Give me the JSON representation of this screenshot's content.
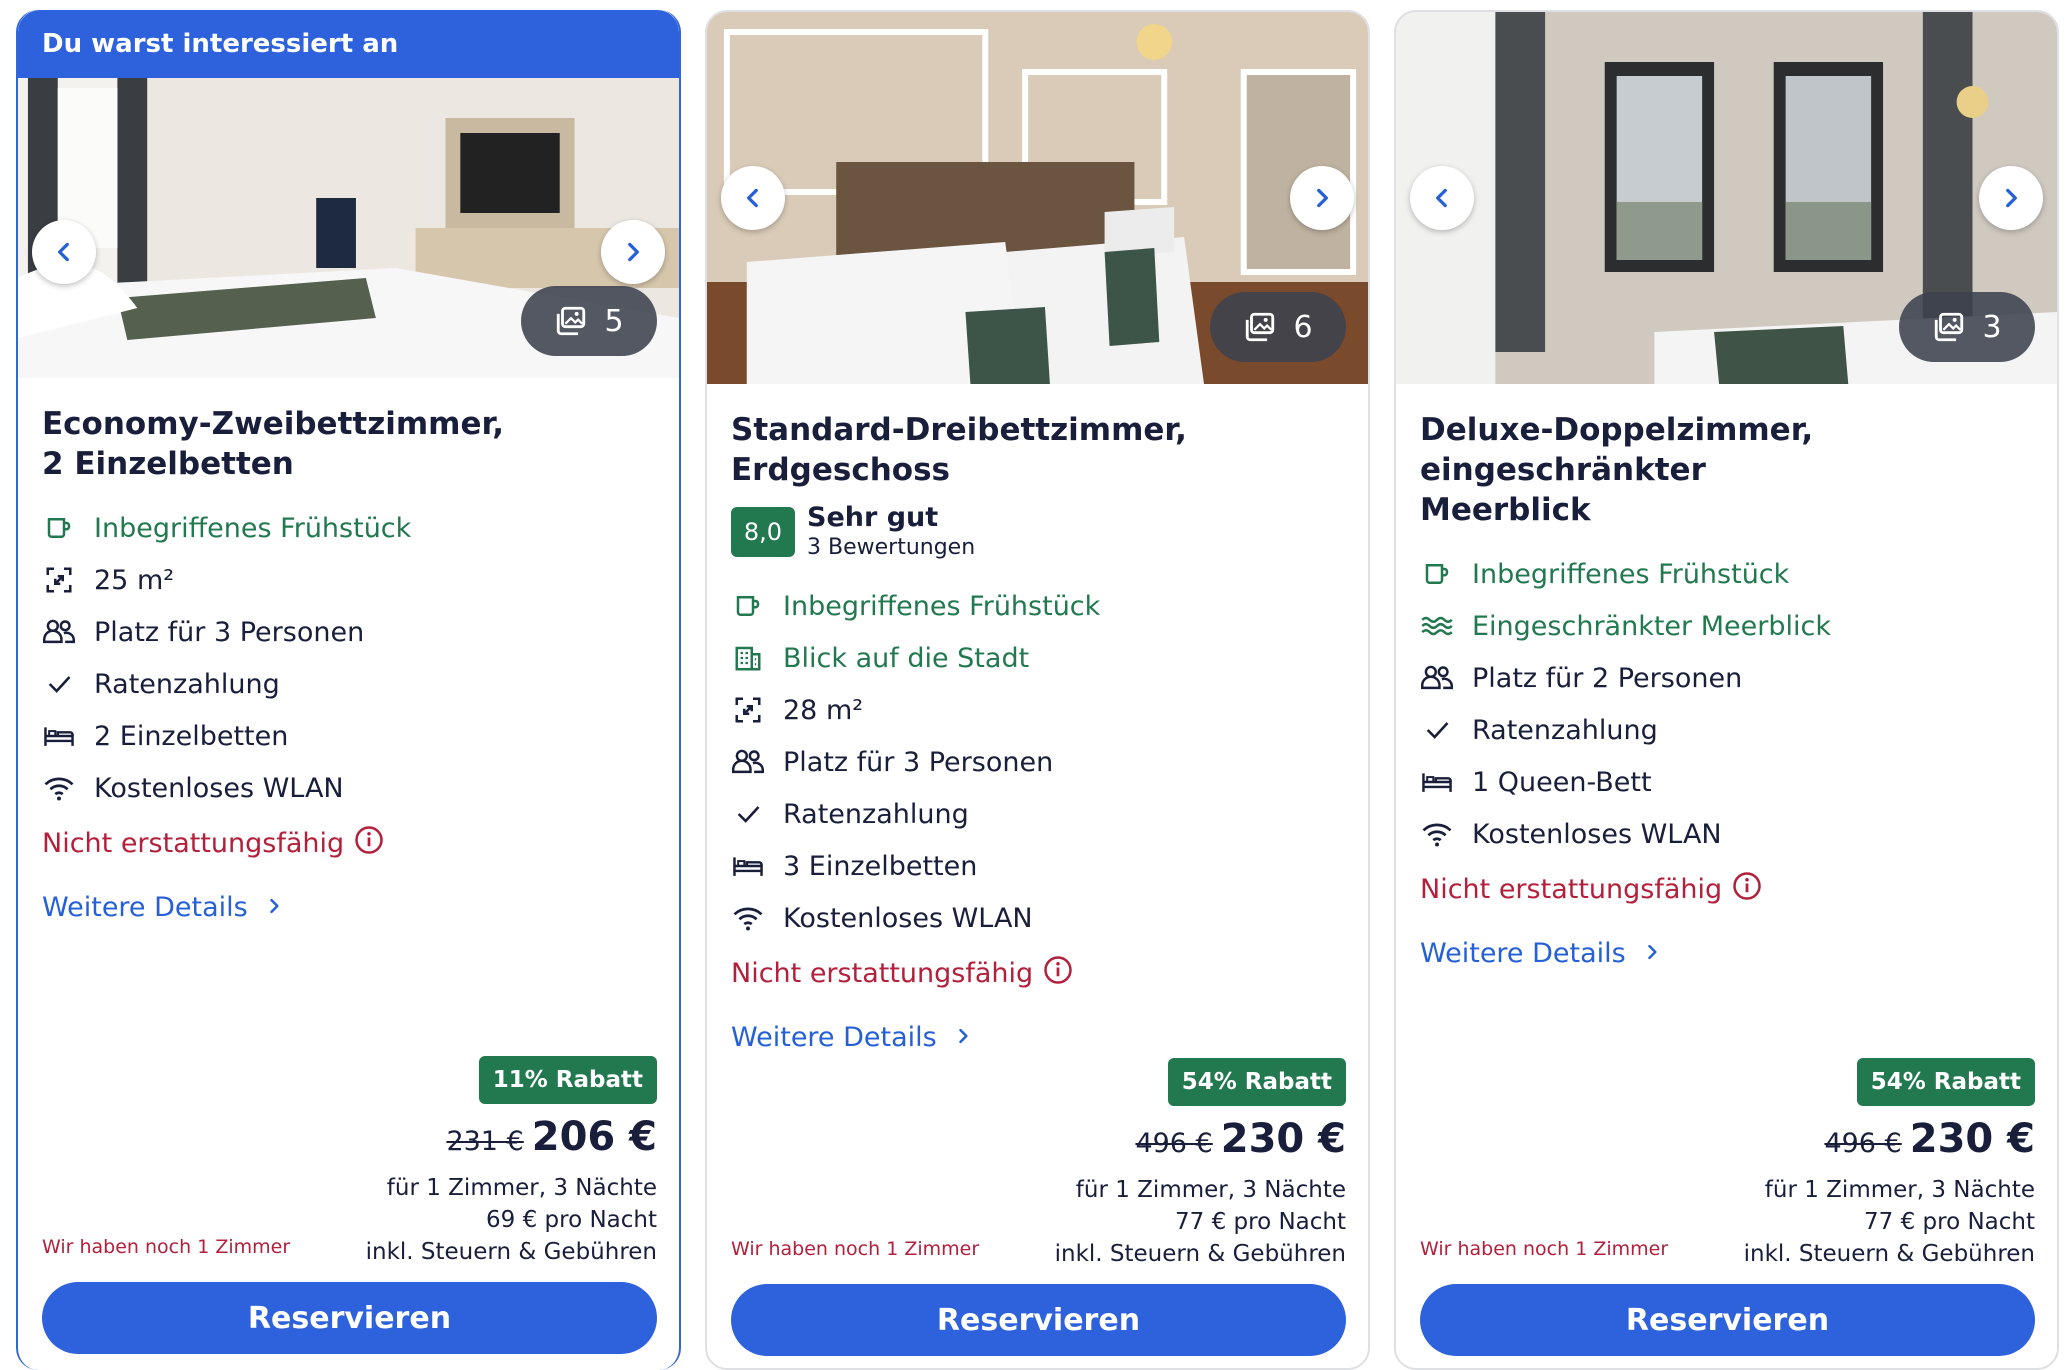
{
  "colors": {
    "brand_blue": "#2e62dc",
    "green": "#227950",
    "red": "#b3203b",
    "link_blue": "#2560d6"
  },
  "cards": [
    {
      "banner": "Du warst interessiert an",
      "photo_count": "5",
      "title": "Economy-Zweibettzimmer, 2 Einzelbetten",
      "title_line1": "Economy-Zweibettzimmer,",
      "title_line2": "2 Einzelbetten",
      "features": [
        {
          "icon": "breakfast-icon",
          "text": "Inbegriffenes Frühstück",
          "highlight": true
        },
        {
          "icon": "room-size-icon",
          "text": "25 m²",
          "highlight": false
        },
        {
          "icon": "guests-icon",
          "text": "Platz für 3 Personen",
          "highlight": false
        },
        {
          "icon": "check-icon",
          "text": "Ratenzahlung",
          "highlight": false
        },
        {
          "icon": "bed-icon",
          "text": "2 Einzelbetten",
          "highlight": false
        },
        {
          "icon": "wifi-icon",
          "text": "Kostenloses WLAN",
          "highlight": false
        }
      ],
      "refund": "Nicht erstattungsfähig",
      "details": "Weitere Details",
      "discount": "11% Rabatt",
      "old_price": "231 €",
      "price": "206 €",
      "price_note1": "für 1 Zimmer, 3 Nächte",
      "price_note2": "69 € pro Nacht",
      "price_note3": "inkl. Steuern & Gebühren",
      "rooms_left": "Wir haben noch 1 Zimmer",
      "reserve": "Reservieren"
    },
    {
      "photo_count": "6",
      "title_line1": "Standard-Dreibettzimmer, Erdgeschoss",
      "score": "8,0",
      "rating_label": "Sehr gut",
      "reviews": "3 Bewertungen",
      "features": [
        {
          "icon": "breakfast-icon",
          "text": "Inbegriffenes Frühstück",
          "highlight": true
        },
        {
          "icon": "city-view-icon",
          "text": "Blick auf die Stadt",
          "highlight": true
        },
        {
          "icon": "room-size-icon",
          "text": "28 m²",
          "highlight": false
        },
        {
          "icon": "guests-icon",
          "text": "Platz für 3 Personen",
          "highlight": false
        },
        {
          "icon": "check-icon",
          "text": "Ratenzahlung",
          "highlight": false
        },
        {
          "icon": "bed-icon",
          "text": "3 Einzelbetten",
          "highlight": false
        },
        {
          "icon": "wifi-icon",
          "text": "Kostenloses WLAN",
          "highlight": false
        }
      ],
      "refund": "Nicht erstattungsfähig",
      "details": "Weitere Details",
      "discount": "54% Rabatt",
      "old_price": "496 €",
      "price": "230 €",
      "price_note1": "für 1 Zimmer, 3 Nächte",
      "price_note2": "77 € pro Nacht",
      "price_note3": "inkl. Steuern & Gebühren",
      "rooms_left": "Wir haben noch 1 Zimmer",
      "reserve": "Reservieren"
    },
    {
      "photo_count": "3",
      "title_line1": "Deluxe-Doppelzimmer, eingeschränkter",
      "title_line2": "Meerblick",
      "features": [
        {
          "icon": "breakfast-icon",
          "text": "Inbegriffenes Frühstück",
          "highlight": true
        },
        {
          "icon": "sea-view-icon",
          "text": "Eingeschränkter Meerblick",
          "highlight": true
        },
        {
          "icon": "guests-icon",
          "text": "Platz für 2 Personen",
          "highlight": false
        },
        {
          "icon": "check-icon",
          "text": "Ratenzahlung",
          "highlight": false
        },
        {
          "icon": "bed-icon",
          "text": "1 Queen-Bett",
          "highlight": false
        },
        {
          "icon": "wifi-icon",
          "text": "Kostenloses WLAN",
          "highlight": false
        }
      ],
      "refund": "Nicht erstattungsfähig",
      "details": "Weitere Details",
      "discount": "54% Rabatt",
      "old_price": "496 €",
      "price": "230 €",
      "price_note1": "für 1 Zimmer, 3 Nächte",
      "price_note2": "77 € pro Nacht",
      "price_note3": "inkl. Steuern & Gebühren",
      "rooms_left": "Wir haben noch 1 Zimmer",
      "reserve": "Reservieren"
    }
  ]
}
